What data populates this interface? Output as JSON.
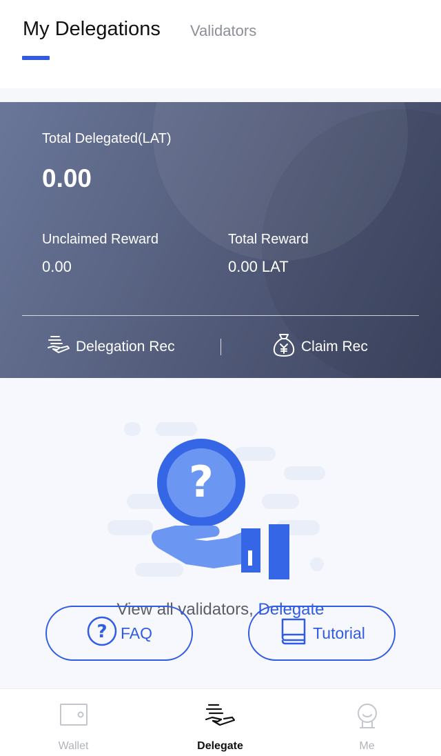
{
  "header": {
    "tabs": [
      {
        "label": "My Delegations",
        "active": true
      },
      {
        "label": "Validators",
        "active": false
      }
    ]
  },
  "summary": {
    "total_delegated_label": "Total Delegated(LAT)",
    "total_delegated_value": "0.00",
    "unclaimed_reward_label": "Unclaimed Reward",
    "unclaimed_reward_value": "0.00",
    "total_reward_label": "Total Reward",
    "total_reward_value": "0.00 LAT",
    "actions": [
      {
        "label": "Delegation Rec",
        "icon": "hand-delegate-icon"
      },
      {
        "label": "Claim Rec",
        "icon": "money-bag-icon"
      }
    ]
  },
  "empty_state": {
    "text": "View all validators, ",
    "link": "Delegate",
    "buttons": [
      {
        "label": "FAQ",
        "icon": "question-circle-icon"
      },
      {
        "label": "Tutorial",
        "icon": "book-icon"
      }
    ]
  },
  "bottom_nav": {
    "items": [
      {
        "label": "Wallet",
        "icon": "wallet-icon",
        "active": false
      },
      {
        "label": "Delegate",
        "icon": "delegate-icon",
        "active": true
      },
      {
        "label": "Me",
        "icon": "profile-icon",
        "active": false
      }
    ]
  },
  "colors": {
    "accent": "#2f5be6",
    "card_gradient_start": "#6a7799",
    "card_gradient_end": "#3c4460",
    "empty_bg": "#f6f8fd"
  }
}
